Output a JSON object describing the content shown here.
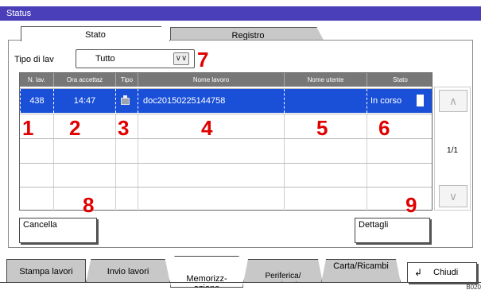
{
  "window": {
    "title": "Status"
  },
  "tabs": [
    {
      "label": "Stato"
    },
    {
      "label": "Registro"
    }
  ],
  "filter": {
    "label": "Tipo di lav",
    "value": "Tutto"
  },
  "table": {
    "columns": [
      "N. lav.",
      "Ora accettaz",
      "Tipo",
      "Nome lavoro",
      "Nome utente",
      "Stato"
    ],
    "rows": [
      {
        "job_no": "438",
        "time": "14:47",
        "type_icon": "print-icon",
        "job_name": "doc20150225144758",
        "user": "",
        "status": "In corso"
      }
    ]
  },
  "pager": {
    "indicator": "1/1",
    "up_icon": "chevron-up-icon",
    "down_icon": "chevron-down-icon"
  },
  "buttons": {
    "cancel": "Cancella",
    "details": "Dettagli",
    "close": "Chiudi"
  },
  "bottom_tabs": [
    {
      "label": "Stampa lavori"
    },
    {
      "label": "Invio lavori"
    },
    {
      "label": "Memorizz-\nazione"
    },
    {
      "label": "Periferica/\nComunicazione"
    },
    {
      "label": "Carta/Ricambi"
    }
  ],
  "callouts": [
    "1",
    "2",
    "3",
    "4",
    "5",
    "6",
    "7",
    "8",
    "9"
  ],
  "corner_code": "B020",
  "colors": {
    "titlebar": "#4a3fb8",
    "selected_row": "#1a50d8",
    "callout": "#e00000"
  }
}
